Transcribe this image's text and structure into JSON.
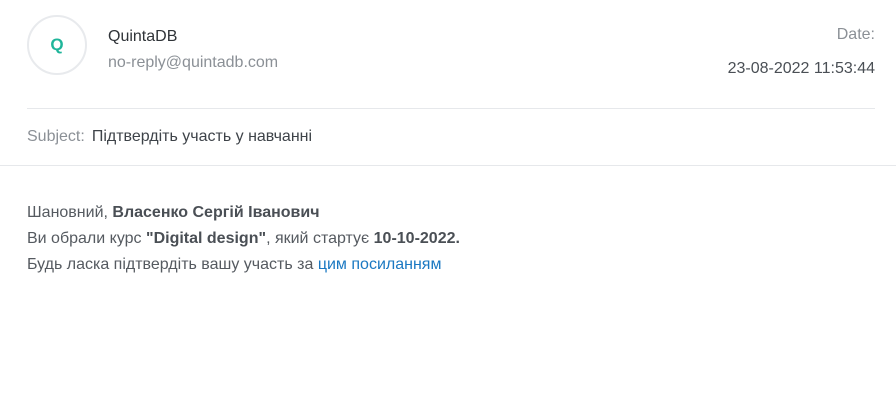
{
  "sender": {
    "avatar_letter": "Q",
    "name": "QuintaDB",
    "email": "no-reply@quintadb.com"
  },
  "date": {
    "label": "Date:",
    "value": "23-08-2022 11:53:44"
  },
  "subject": {
    "label": "Subject:",
    "text": "Підтвердіть участь у навчанні"
  },
  "body": {
    "greeting_prefix": "Шановний, ",
    "recipient_name": "Власенко Сергій Іванович",
    "course_prefix": "Ви обрали курс ",
    "course_name": "\"Digital design\"",
    "course_middle": ", який стартує ",
    "course_date": "10-10-2022.",
    "confirm_prefix": "Будь ласка підтвердіть вашу участь за ",
    "confirm_link": "цим посиланням"
  },
  "colors": {
    "accent": "#1fb59a",
    "link": "#1a78c2"
  }
}
